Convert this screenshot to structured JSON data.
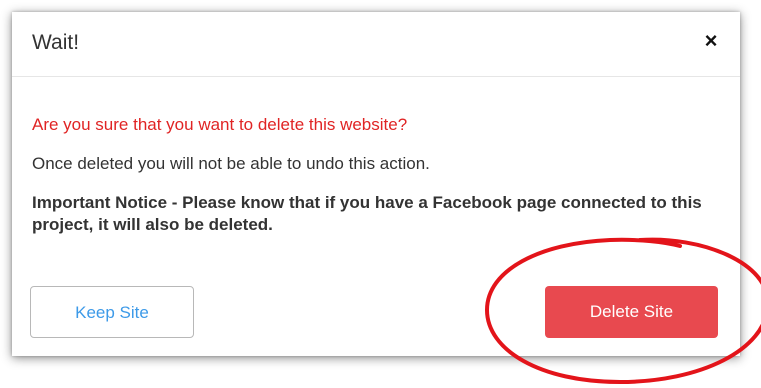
{
  "dialog": {
    "title": "Wait!",
    "close_symbol": "×",
    "warning_text": "Are you sure that you want to delete this website?",
    "undo_text": "Once deleted you will not be able to undo this action.",
    "notice_text": "Important Notice - Please know that if you have a Facebook page connected to this project, it will also be deleted."
  },
  "buttons": {
    "keep_label": "Keep Site",
    "delete_label": "Delete Site"
  },
  "colors": {
    "warning_text": "#e02424",
    "keep_text": "#3d9ae8",
    "delete_bg": "#e8494f",
    "annotation_ring": "#e3141a"
  },
  "icons": {
    "close": "close-icon"
  }
}
